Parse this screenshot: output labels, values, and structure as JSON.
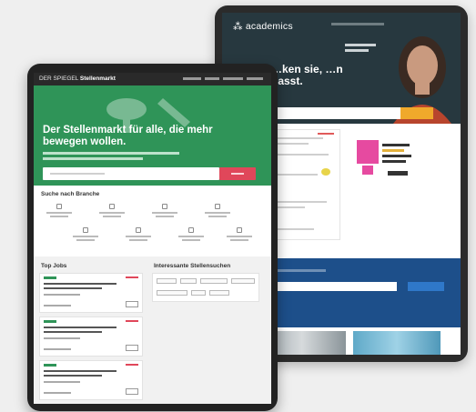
{
  "back_site": {
    "logo": "academics",
    "headline": "…ken sie, …n passt.",
    "accent": "#f0a92b",
    "band_color": "#1d4f8a"
  },
  "front_site": {
    "logo": "DER SPIEGEL",
    "logo_sub": "Stellenmarkt",
    "hero_title": "Der Stellenmarkt für alle, die mehr bewegen wollen.",
    "hero_color": "#2f9458",
    "search_button_color": "#e0475a",
    "branch_title": "Suche nach Branche",
    "top_jobs_title": "Top Jobs",
    "interesting_title": "Interessante Stellensuchen"
  }
}
